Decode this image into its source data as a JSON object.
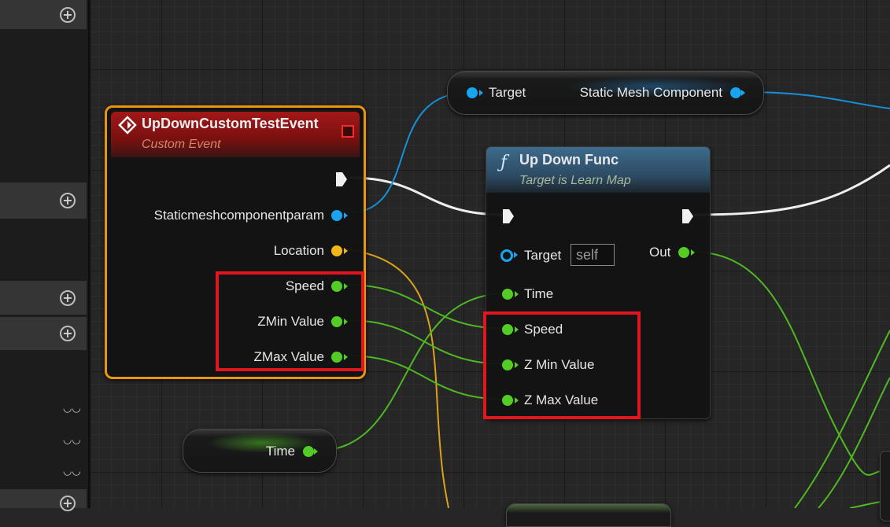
{
  "left_panel": {
    "add_symbol": "+",
    "eye_symbol": "◡◡"
  },
  "event_node": {
    "title": "UpDownCustomTestEvent",
    "subtitle": "Custom Event",
    "pins": {
      "param": "Staticmeshcomponentparam",
      "location": "Location",
      "speed": "Speed",
      "zmin": "ZMin Value",
      "zmax": "ZMax Value"
    }
  },
  "target_node": {
    "input_label": "Target",
    "output_label": "Static Mesh Component"
  },
  "func_node": {
    "function_symbol": "ƒ",
    "title": "Up Down Func",
    "subtitle": "Target is Learn Map",
    "target_label": "Target",
    "target_default": "self",
    "out_label": "Out",
    "time_label": "Time",
    "speed_label": "Speed",
    "zmin_label": "Z Min Value",
    "zmax_label": "Z Max Value"
  },
  "time_node": {
    "label": "Time"
  },
  "colors": {
    "exec": "#f0f0f0",
    "object_pin": "#19a4f0",
    "vector_pin": "#f4b519",
    "float_pin": "#54cc26",
    "highlight": "#e3151f",
    "event_header": "#8e1414",
    "event_border": "#e8960e",
    "func_header": "#3f6c8e"
  }
}
